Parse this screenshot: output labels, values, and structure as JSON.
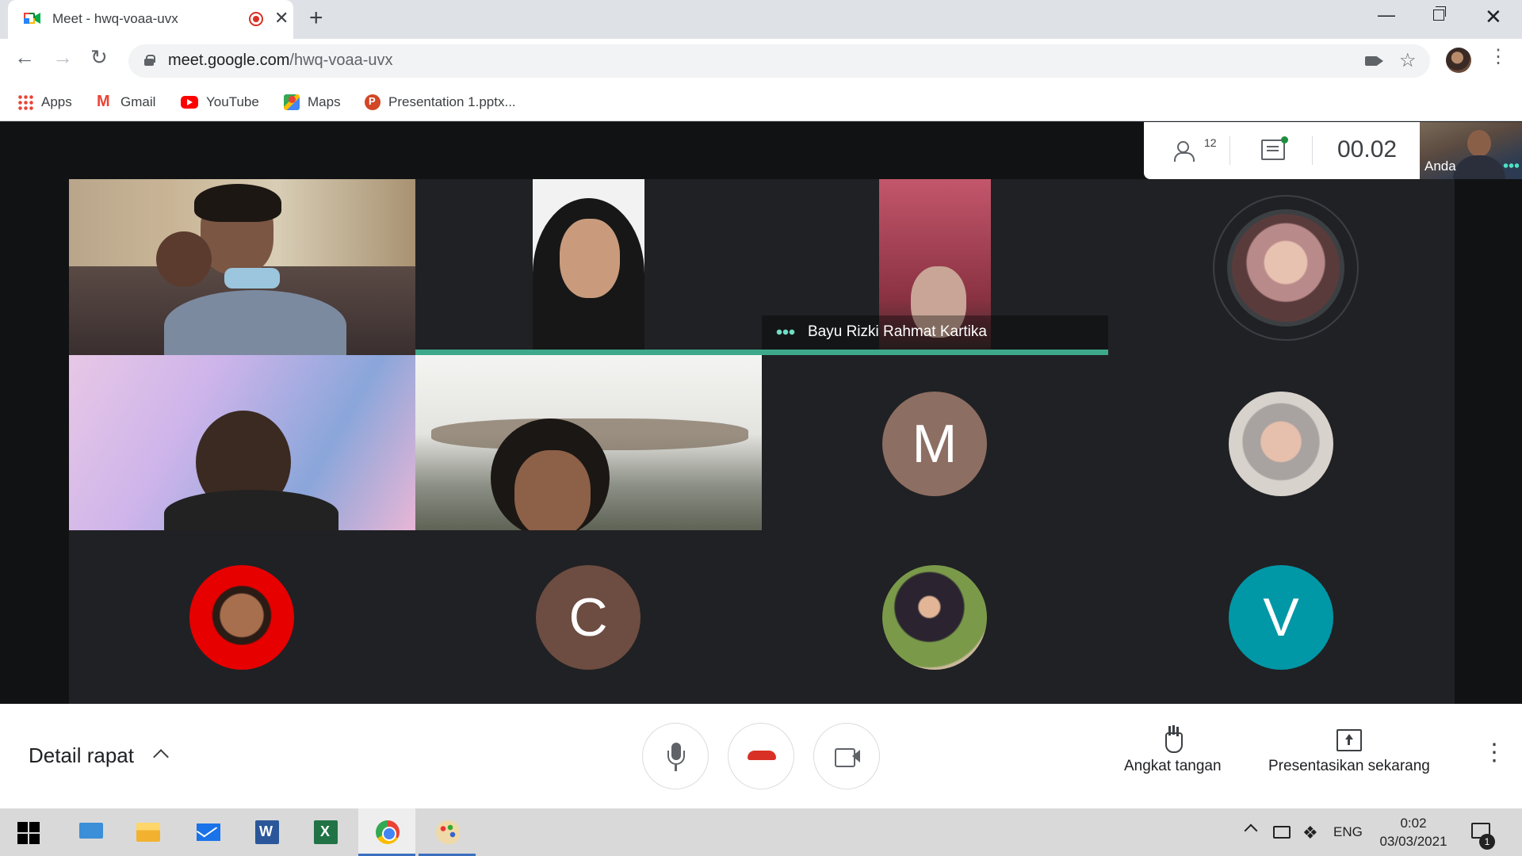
{
  "browser": {
    "tab_title": "Meet - hwq-voaa-uvx",
    "tab_close": "✕",
    "new_tab": "+",
    "url_host": "meet.google.com",
    "url_path": "/hwq-voaa-uvx",
    "nav_back": "←",
    "nav_forward": "→",
    "nav_reload": "↻",
    "star": "☆",
    "menu": "⋮",
    "window_min": "—",
    "window_close": "✕"
  },
  "bookmarks": [
    {
      "label": "Apps"
    },
    {
      "label": "Gmail"
    },
    {
      "label": "YouTube"
    },
    {
      "label": "Maps"
    },
    {
      "label": "Presentation 1.pptx..."
    }
  ],
  "meet": {
    "participant_count": "12",
    "timer": "00.02",
    "self_label": "Anda",
    "speaking_name": "Bayu Rizki Rahmat Kartika",
    "avatars": [
      {
        "initial": "M",
        "color": "#8d6e63"
      },
      {
        "initial": "C",
        "color": "#6d4c41"
      },
      {
        "initial": "V",
        "color": "#0097a7"
      }
    ],
    "controls": {
      "meeting_details": "Detail rapat",
      "raise_hand": "Angkat tangan",
      "present_now": "Presentasikan sekarang",
      "more": "⋮"
    }
  },
  "taskbar": {
    "language": "ENG",
    "time": "0:02",
    "date": "03/03/2021",
    "notification_count": "1",
    "dropbox_glyph": "❖"
  }
}
